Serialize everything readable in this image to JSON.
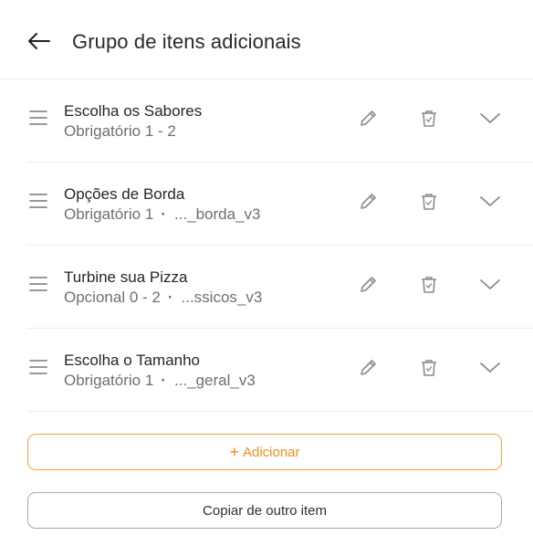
{
  "header": {
    "title": "Grupo de itens adicionais"
  },
  "groups": [
    {
      "title": "Escolha os Sabores",
      "status": "Obrigatório 1 - 2",
      "code": ""
    },
    {
      "title": "Opções de Borda",
      "status": "Obrigatório 1",
      "code": "..._borda_v3"
    },
    {
      "title": "Turbine sua Pizza",
      "status": "Opcional 0 - 2",
      "code": "...ssicos_v3"
    },
    {
      "title": "Escolha o Tamanho",
      "status": "Obrigatório 1",
      "code": "..._geral_v3"
    }
  ],
  "actions": {
    "add_icon": "+",
    "add_label": "Adicionar",
    "copy_label": "Copiar de outro item"
  },
  "colors": {
    "accent": "#f08c1e",
    "icon_gray": "#8a8a8a",
    "divider": "#ececec"
  },
  "icons": [
    "arrow-left-icon",
    "drag-handle-icon",
    "pencil-icon",
    "trash-icon",
    "chevron-down-icon"
  ]
}
